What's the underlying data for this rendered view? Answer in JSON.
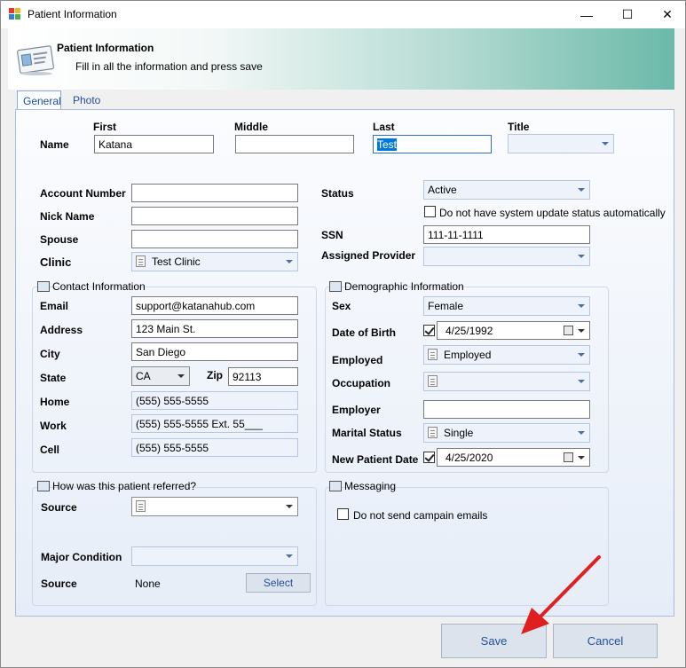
{
  "window": {
    "title": "Patient Information",
    "minimize": "—",
    "maximize": "☐",
    "close": "✕"
  },
  "banner": {
    "title": "Patient Information",
    "subtitle": "Fill in all the information and press save"
  },
  "tabs": [
    "General",
    "Photo"
  ],
  "name": {
    "label": "Name",
    "first_label": "First",
    "first_value": "Katana",
    "middle_label": "Middle",
    "middle_value": "",
    "last_label": "Last",
    "last_value": "Test",
    "title_label": "Title",
    "title_value": ""
  },
  "account": {
    "account_number_label": "Account Number",
    "account_number_value": "",
    "nick_name_label": "Nick Name",
    "nick_name_value": "",
    "spouse_label": "Spouse",
    "spouse_value": "",
    "clinic_label": "Clinic",
    "clinic_value": "Test Clinic"
  },
  "status": {
    "status_label": "Status",
    "status_value": "Active",
    "auto_update_label": "Do not have system update status automatically",
    "ssn_label": "SSN",
    "ssn_value": "111-11-1111",
    "provider_label": "Assigned Provider",
    "provider_value": ""
  },
  "contact": {
    "title": "Contact Information",
    "email_label": "Email",
    "email_value": "support@katanahub.com",
    "address_label": "Address",
    "address_value": "123 Main St.",
    "city_label": "City",
    "city_value": "San Diego",
    "state_label": "State",
    "state_value": "CA",
    "zip_label": "Zip",
    "zip_value": "92113",
    "home_label": "Home",
    "home_value": "(555) 555-5555",
    "work_label": "Work",
    "work_value": "(555) 555-5555 Ext. 55___",
    "cell_label": "Cell",
    "cell_value": "(555) 555-5555"
  },
  "demographic": {
    "title": "Demographic Information",
    "sex_label": "Sex",
    "sex_value": "Female",
    "dob_label": "Date of Birth",
    "dob_value": "4/25/1992",
    "employed_label": "Employed",
    "employed_value": "Employed",
    "occupation_label": "Occupation",
    "occupation_value": "",
    "employer_label": "Employer",
    "employer_value": "",
    "marital_label": "Marital Status",
    "marital_value": "Single",
    "npd_label": "New Patient Date",
    "npd_value": "4/25/2020"
  },
  "referral": {
    "title": "How was this patient referred?",
    "source_label": "Source",
    "source_value": "",
    "major_label": "Major Condition",
    "major_value": "",
    "source2_label": "Source",
    "source2_value": "None",
    "select_label": "Select"
  },
  "messaging": {
    "title": "Messaging",
    "no_campaign_label": "Do not send campain emails"
  },
  "footer": {
    "save_label": "Save",
    "cancel_label": "Cancel"
  },
  "colors": {
    "accent": "#1f4f9a",
    "banner_end": "#6bb9a9",
    "arrow": "#e02020"
  }
}
